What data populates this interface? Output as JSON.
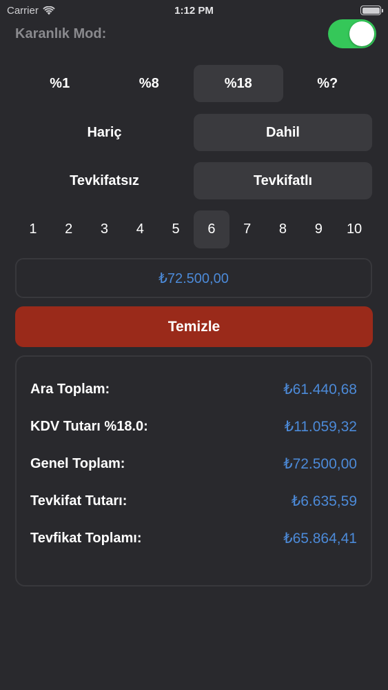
{
  "status": {
    "carrier": "Carrier",
    "time": "1:12 PM"
  },
  "dark_mode": {
    "label": "Karanlık Mod:",
    "enabled": true,
    "accent_color": "#35c759"
  },
  "vat_rates": {
    "options": [
      "%1",
      "%8",
      "%18",
      "%?"
    ],
    "selected": "%18"
  },
  "inclusion": {
    "options": [
      "Hariç",
      "Dahil"
    ],
    "selected": "Dahil"
  },
  "withholding": {
    "options": [
      "Tevkifatsız",
      "Tevkifatlı"
    ],
    "selected": "Tevkifatlı"
  },
  "withholding_ratio": {
    "options": [
      "1",
      "2",
      "3",
      "4",
      "5",
      "6",
      "7",
      "8",
      "9",
      "10"
    ],
    "selected": "6"
  },
  "amount_input": {
    "value": "₺72.500,00"
  },
  "clear_button": {
    "label": "Temizle",
    "color": "#9a2a1a"
  },
  "results": [
    {
      "label": "Ara Toplam:",
      "value": "₺61.440,68"
    },
    {
      "label": "KDV Tutarı %18.0:",
      "value": "₺11.059,32"
    },
    {
      "label": "Genel Toplam:",
      "value": "₺72.500,00"
    },
    {
      "label": "Tevkifat Tutarı:",
      "value": "₺6.635,59"
    },
    {
      "label": "Tevfikat Toplamı:",
      "value": "₺65.864,41"
    }
  ],
  "colors": {
    "background": "#29292d",
    "value_blue": "#4c8ad8",
    "selected_segment": "#3a3a3e"
  }
}
